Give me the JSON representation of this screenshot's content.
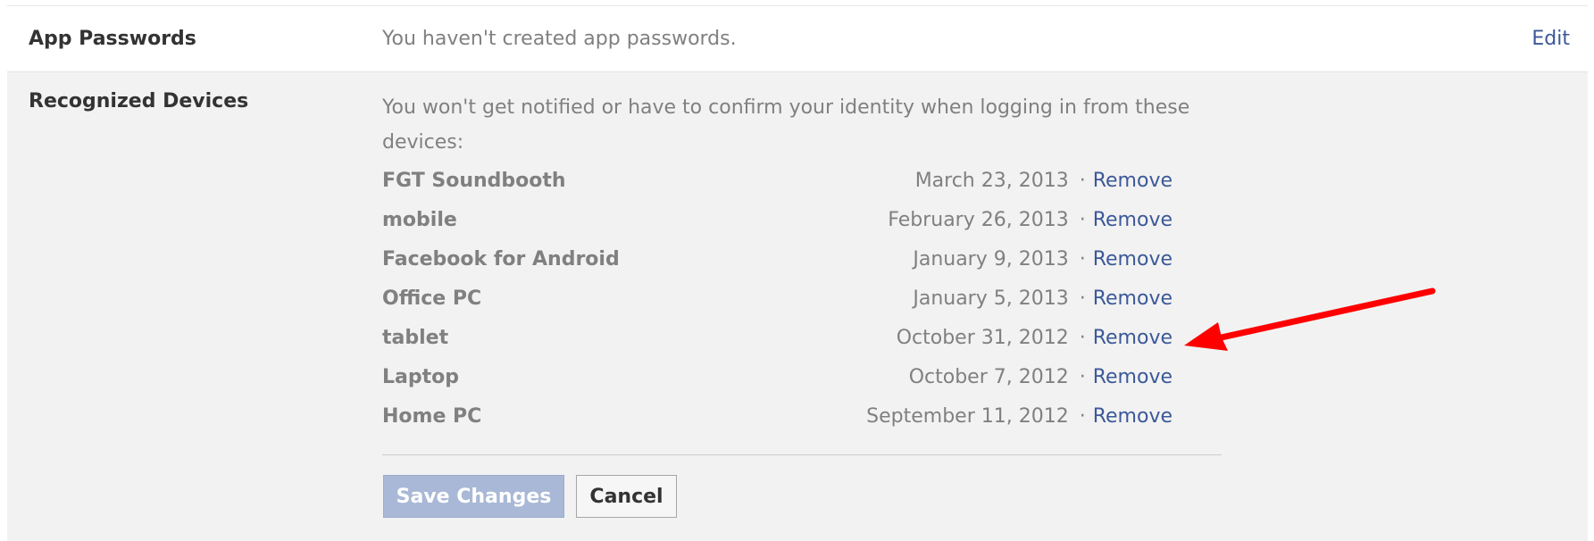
{
  "app_passwords": {
    "label": "App Passwords",
    "text": "You haven't created app passwords.",
    "edit_label": "Edit"
  },
  "recognized_devices": {
    "label": "Recognized Devices",
    "intro": "You won't get notified or have to confirm your identity when logging in from these devices:",
    "remove_label": "Remove",
    "separator": "·",
    "devices": [
      {
        "name": "FGT Soundbooth",
        "date": "March 23, 2013"
      },
      {
        "name": "mobile",
        "date": "February 26, 2013"
      },
      {
        "name": "Facebook for Android",
        "date": "January 9, 2013"
      },
      {
        "name": "Office PC",
        "date": "January 5, 2013"
      },
      {
        "name": "tablet",
        "date": "October 31, 2012"
      },
      {
        "name": "Laptop",
        "date": "October 7, 2012"
      },
      {
        "name": "Home PC",
        "date": "September 11, 2012"
      }
    ]
  },
  "actions": {
    "save_label": "Save Changes",
    "cancel_label": "Cancel"
  },
  "annotation": {
    "arrow_color": "#ff0000",
    "points_to_device": "tablet"
  },
  "colors": {
    "link": "#3b5998",
    "muted_text": "#808080",
    "label_text": "#333333",
    "section_bg": "#f2f2f2",
    "save_button_bg": "#a9b8d6"
  }
}
